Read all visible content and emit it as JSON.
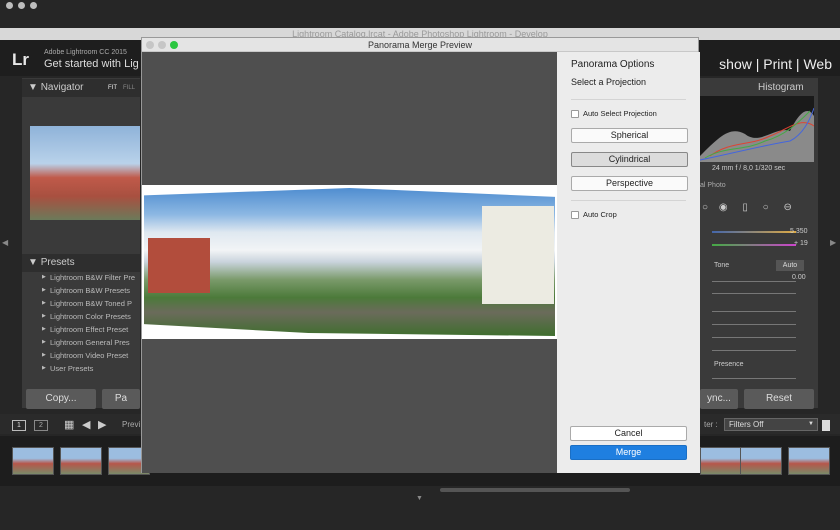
{
  "window": {
    "title": "Lightroom Catalog.lrcat - Adobe Photoshop Lightroom - Develop"
  },
  "lr": {
    "logo": "Lr",
    "version": "Adobe Lightroom CC 2015",
    "tagline": "Get started with Lig",
    "modules": "show  |  Print  |  Web"
  },
  "left": {
    "navigator": "Navigator",
    "fit": "FIT",
    "fill": "FILL",
    "presets_header": "Presets",
    "presets": [
      "Lightroom B&W Filter Pre",
      "Lightroom B&W Presets",
      "Lightroom B&W Toned P",
      "Lightroom Color Presets",
      "Lightroom Effect Preset",
      "Lightroom General Pres",
      "Lightroom Video Preset",
      "User Presets"
    ],
    "copy": "Copy...",
    "paste": "Pa"
  },
  "right": {
    "histogram": "Histogram",
    "meta": "24 mm    f / 8,0    1/320 sec",
    "orig": "al Photo",
    "temp": "5 350",
    "tint": "+ 19",
    "tone": "Tone",
    "auto": "Auto",
    "exposure": "0.00",
    "presence": "Presence",
    "sync": "ync...",
    "reset": "Reset"
  },
  "filmbar": {
    "one": "1",
    "two": "2",
    "prev": "Previ",
    "filter": "ter :",
    "filters_off": "Filters Off"
  },
  "dialog": {
    "title": "Panorama Merge Preview",
    "options_title": "Panorama Options",
    "projection_label": "Select a Projection",
    "auto_projection": "Auto Select Projection",
    "spherical": "Spherical",
    "cylindrical": "Cylindrical",
    "perspective": "Perspective",
    "auto_crop": "Auto Crop",
    "cancel": "Cancel",
    "merge": "Merge"
  },
  "colors": {
    "merge_blue": "#1f7fe0",
    "close_red": "#fc5b57",
    "min_yellow": "#e6be2e",
    "zoom_green": "#2bc640"
  }
}
